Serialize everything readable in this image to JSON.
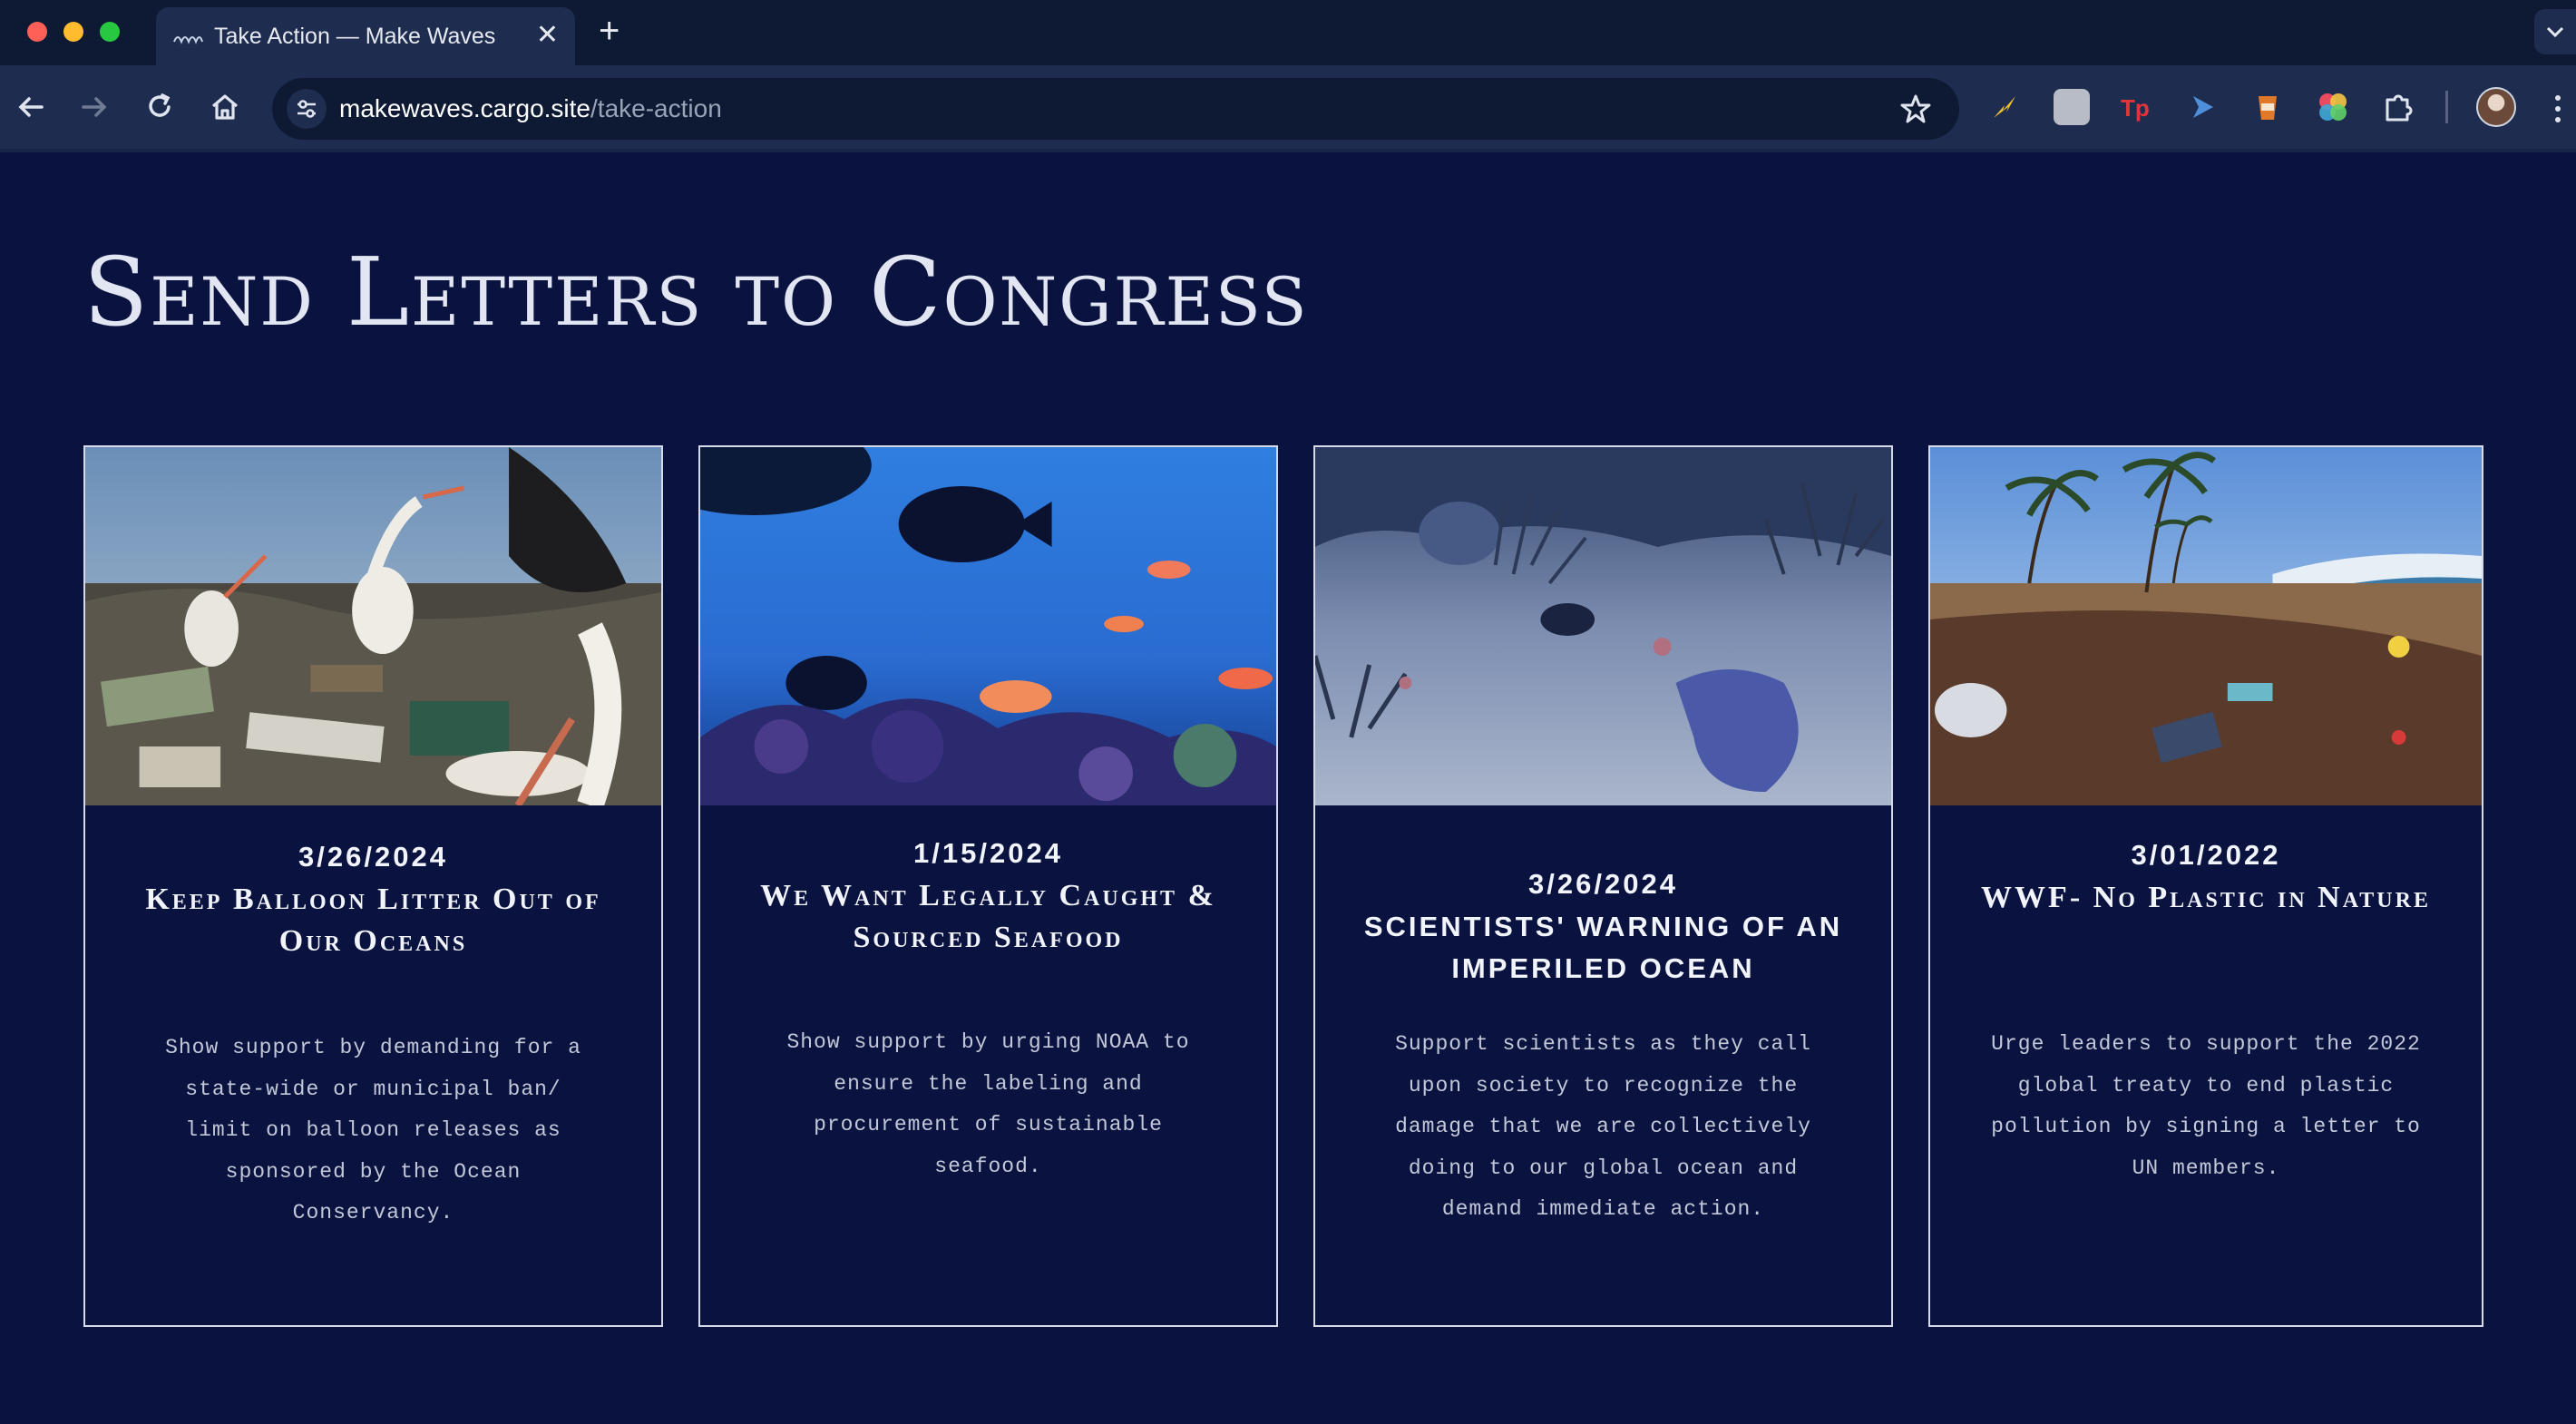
{
  "browser": {
    "tab_title": "Take Action — Make Waves",
    "url_host": "makewaves.cargo.site",
    "url_path": "/take-action",
    "tab_close_glyph": "✕",
    "new_tab_glyph": "+"
  },
  "page": {
    "heading": "Send Letters to Congress"
  },
  "cards": [
    {
      "date": "3/26/2024",
      "title": "Keep Balloon Litter Out of Our Oceans",
      "description": "Show support by demanding for a state-wide or municipal ban/ limit on balloon releases as sponsored by the Ocean Conservancy.",
      "image": "storks-in-landfill"
    },
    {
      "date": "1/15/2024",
      "title": "We Want Legally Caught & Sourced Seafood",
      "description": "Show support by urging NOAA to ensure the labeling and procurement of sustainable seafood.",
      "image": "reef-fish-aquarium"
    },
    {
      "date": "3/26/2024",
      "title": "SCIENTISTS' WARNING OF AN IMPERILED OCEAN",
      "description": "Support scientists as they call upon society to recognize the damage that we are collectively doing to our global ocean and demand immediate action.",
      "image": "bleached-seafloor"
    },
    {
      "date": "3/01/2022",
      "title": "WWF- No Plastic in Nature",
      "description": "Urge leaders to support the 2022 global treaty to end plastic pollution by signing a letter to UN members.",
      "image": "plastic-on-beach"
    }
  ],
  "colors": {
    "page_background": "#0a1340",
    "card_border": "#d6dae8",
    "tab_bar": "#0e1a33",
    "toolbar": "#1e2d4f"
  }
}
